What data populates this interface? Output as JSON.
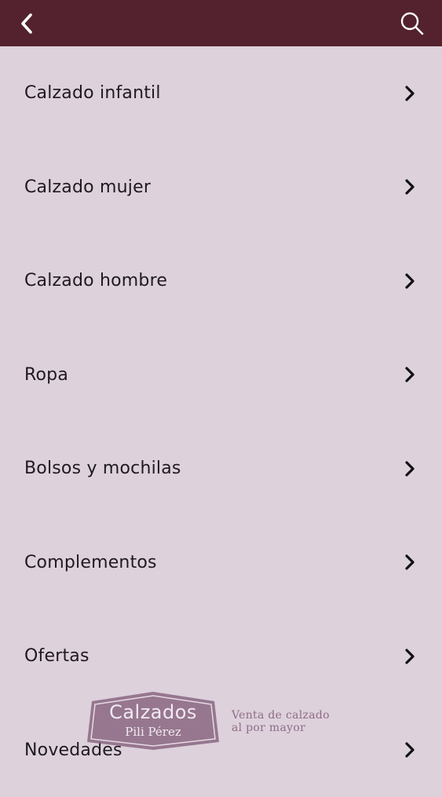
{
  "header": {
    "back_icon": "chevron-left-icon",
    "search_icon": "search-icon",
    "background": "#54212e"
  },
  "menu": {
    "items": [
      {
        "label": "Calzado infantil"
      },
      {
        "label": "Calzado mujer"
      },
      {
        "label": "Calzado hombre"
      },
      {
        "label": "Ropa"
      },
      {
        "label": "Bolsos y mochilas"
      },
      {
        "label": "Complementos"
      },
      {
        "label": "Ofertas"
      },
      {
        "label": "Novedades"
      }
    ],
    "chevron_icon": "chevron-right-icon"
  },
  "watermark": {
    "brand": "Calzados",
    "brand_sub": "Pili Pérez",
    "tagline_line1": "Venta de calzado",
    "tagline_line2": "al por mayor"
  },
  "colors": {
    "background": "#ddd1dc",
    "text": "#1e1a1e",
    "brand": "#8a6781"
  }
}
